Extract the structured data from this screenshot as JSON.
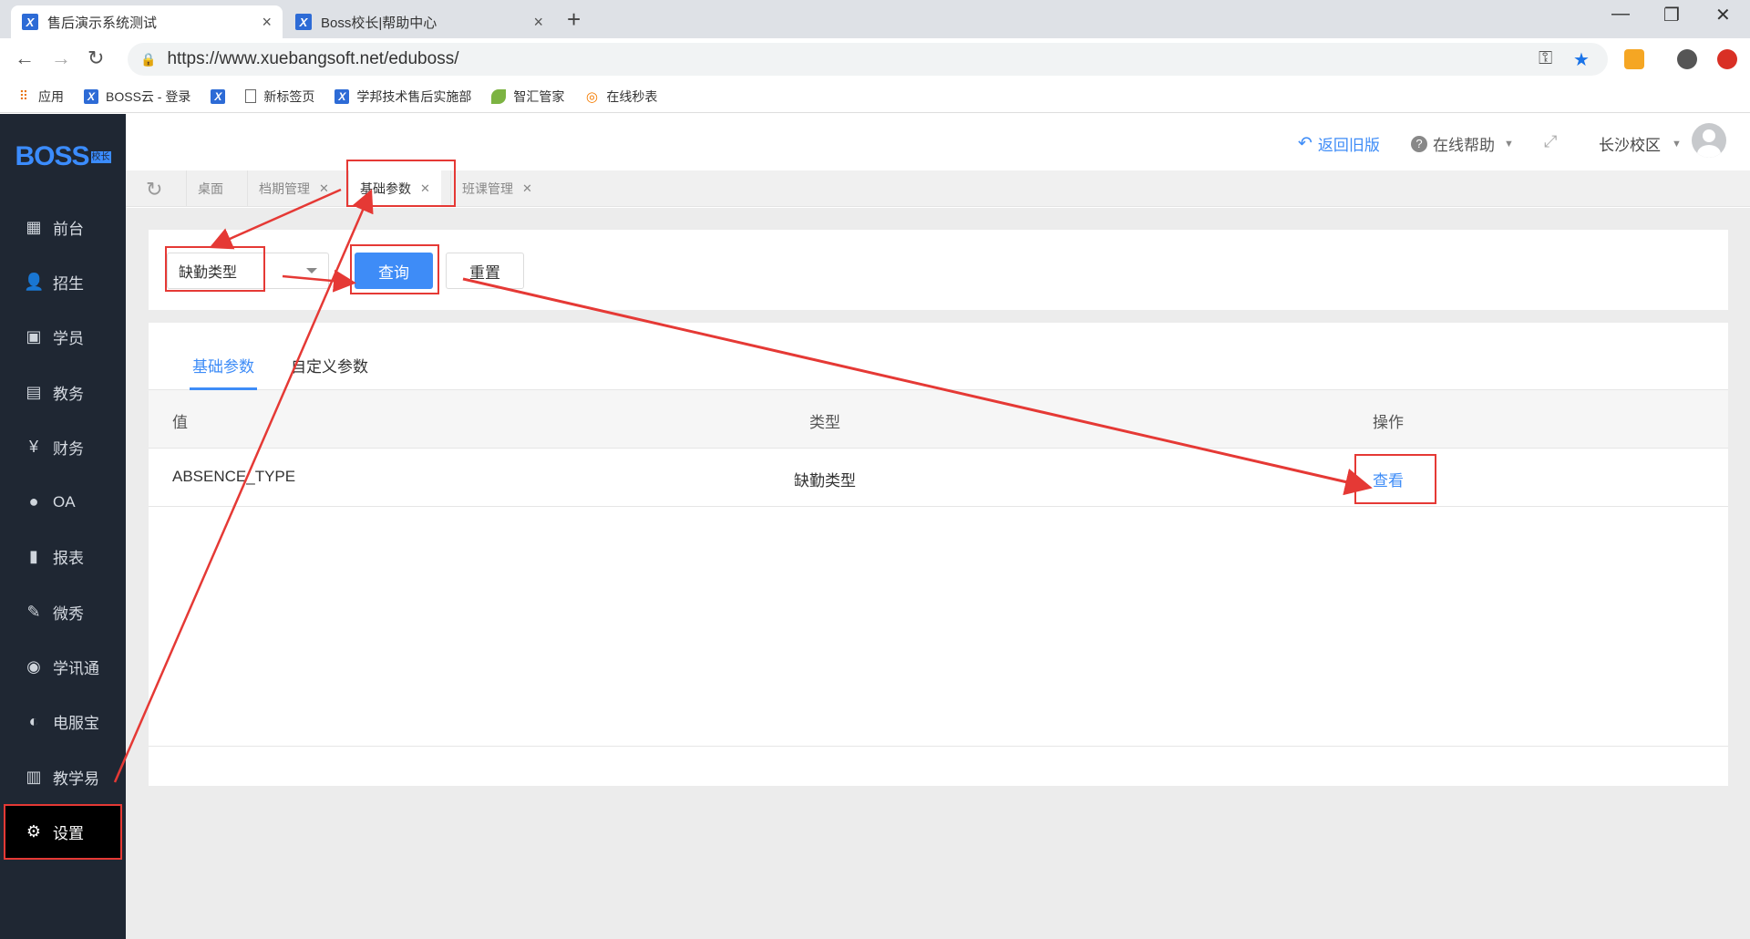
{
  "browser": {
    "tabs": [
      {
        "title": "售后演示系统测试",
        "active": true
      },
      {
        "title": "Boss校长|帮助中心",
        "active": false
      }
    ],
    "url": "https://www.xuebangsoft.net/eduboss/",
    "bookmarks": [
      "应用",
      "BOSS云 - 登录",
      "新标签页",
      "学邦技术售后实施部",
      "智汇管家",
      "在线秒表"
    ]
  },
  "sidebar": {
    "logo": "BOSS",
    "logo_sub": "校长",
    "items": [
      {
        "label": "前台",
        "icon": "calendar-icon"
      },
      {
        "label": "招生",
        "icon": "user-add-icon"
      },
      {
        "label": "学员",
        "icon": "student-card-icon"
      },
      {
        "label": "教务",
        "icon": "book-icon"
      },
      {
        "label": "财务",
        "icon": "yen-icon"
      },
      {
        "label": "OA",
        "icon": "chat-icon"
      },
      {
        "label": "报表",
        "icon": "bar-chart-icon"
      },
      {
        "label": "微秀",
        "icon": "xiu-icon"
      },
      {
        "label": "学讯通",
        "icon": "location-icon"
      },
      {
        "label": "电服宝",
        "icon": "phone-icon"
      },
      {
        "label": "教学易",
        "icon": "teach-icon"
      },
      {
        "label": "设置",
        "icon": "gear-icon",
        "active": true
      }
    ]
  },
  "header": {
    "back_old": "返回旧版",
    "help": "在线帮助",
    "campus": "长沙校区"
  },
  "page_tabs": [
    {
      "label": "桌面",
      "closable": false
    },
    {
      "label": "档期管理",
      "closable": true
    },
    {
      "label": "基础参数",
      "closable": true,
      "active": true
    },
    {
      "label": "班课管理",
      "closable": true
    }
  ],
  "search": {
    "select_value": "缺勤类型",
    "query_label": "查询",
    "reset_label": "重置"
  },
  "subtabs": [
    "基础参数",
    "自定义参数"
  ],
  "table": {
    "headers": [
      "值",
      "类型",
      "操作"
    ],
    "rows": [
      {
        "value": "ABSENCE_TYPE",
        "type": "缺勤类型",
        "action": "查看"
      }
    ]
  },
  "colors": {
    "accent": "#3e8cf7",
    "annotation": "#e53935",
    "sidebar_bg": "#1f2733"
  }
}
